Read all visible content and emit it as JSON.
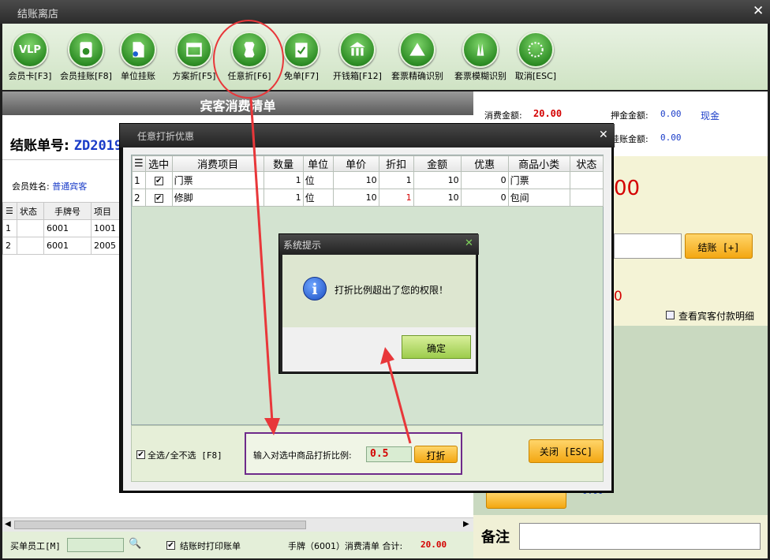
{
  "window": {
    "title": "结账离店"
  },
  "toolbar": {
    "items": [
      {
        "label": "会员卡[F3]",
        "icon": "vip-card-icon",
        "text": "VLP"
      },
      {
        "label": "会员挂账[F8]",
        "icon": "member-charge-icon"
      },
      {
        "label": "单位挂账",
        "icon": "company-charge-icon"
      },
      {
        "label": "方案折[F5]",
        "icon": "scheme-discount-icon"
      },
      {
        "label": "任意折[F6]",
        "icon": "custom-discount-icon"
      },
      {
        "label": "免单[F7]",
        "icon": "free-order-icon"
      },
      {
        "label": "开钱箱[F12]",
        "icon": "cash-drawer-icon"
      },
      {
        "label": "套票精确识别",
        "icon": "ticket-exact-icon"
      },
      {
        "label": "套票模糊识别",
        "icon": "ticket-fuzzy-icon"
      },
      {
        "label": "取消[ESC]",
        "icon": "cancel-icon"
      }
    ]
  },
  "left": {
    "header": "宾客消费清单",
    "bill_label": "结账单号:",
    "bill_no": "ZD2019",
    "member_label": "会员姓名:",
    "member_value": "普通宾客",
    "list_headers": [
      "状态",
      "手牌号",
      "项目"
    ],
    "list_rows": [
      [
        "1",
        "",
        "6001",
        "1001"
      ],
      [
        "2",
        "",
        "6001",
        "2005"
      ]
    ],
    "footer_staff_label": "买单员工[M]",
    "footer_print_label": "结账时打印账单",
    "footer_summary_prefix": "手牌（6001）消费清单 合计:",
    "footer_total": "20.00"
  },
  "right": {
    "consume_label": "消费金额:",
    "consume_value": "20.00",
    "deposit_label": "押金金额:",
    "deposit_value": "0.00",
    "cash": "现金",
    "charge_label": "挂账金额:",
    "charge_value": "0.00",
    "big_partial": "00",
    "checkout_btn": "结账 [+]",
    "red_partial": "0",
    "view_guest_payment": "查看宾客付款明细",
    "partial_value": "0.00",
    "remark_label": "备注"
  },
  "discount_dialog": {
    "title": "任意打折优惠",
    "headers": [
      "选中",
      "消费项目",
      "数量",
      "单位",
      "单价",
      "折扣",
      "金额",
      "优惠",
      "商品小类",
      "状态"
    ],
    "rows": [
      {
        "idx": "1",
        "item": "门票",
        "qty": "1",
        "unit": "位",
        "price": "10",
        "discount": "1",
        "amount": "10",
        "offer": "0",
        "category": "门票",
        "status": ""
      },
      {
        "idx": "2",
        "item": "修脚",
        "qty": "1",
        "unit": "位",
        "price": "10",
        "discount": "1",
        "amount": "10",
        "offer": "0",
        "category": "包间",
        "status": ""
      }
    ],
    "select_all": "全选/全不选 [F8]",
    "ratio_label": "输入对选中商品打折比例:",
    "ratio_value": "0.5",
    "apply_btn": "打折",
    "close_btn": "关闭 [ESC]"
  },
  "alert": {
    "title": "系统提示",
    "message": "打折比例超出了您的权限！",
    "ok": "确定"
  },
  "colors": {
    "red": "#d40000",
    "blue": "#1a3cc8",
    "orange": "#f3a712",
    "green": "#3a9a2a",
    "annotation": "#e8373a",
    "purple": "#6e2a8a"
  }
}
